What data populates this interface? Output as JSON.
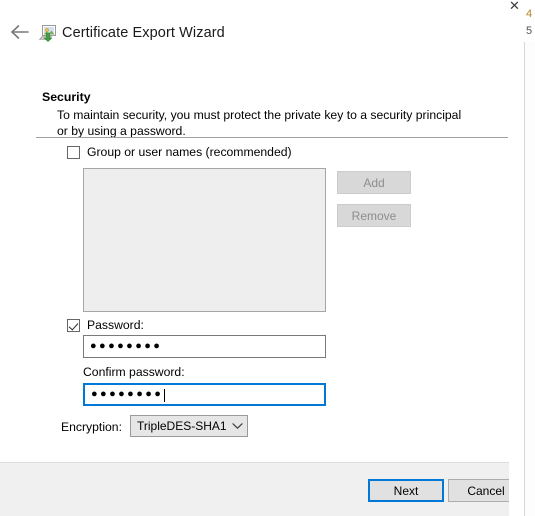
{
  "window": {
    "title": "Certificate Export Wizard",
    "back_icon": "back-arrow-icon",
    "app_icon": "certificate-export-icon"
  },
  "background_window": {
    "close_label": "✕",
    "fragment_top": "4",
    "fragment_second": "5"
  },
  "page": {
    "heading": "Security",
    "description": "To maintain security, you must protect the private key to a security principal or by using a password."
  },
  "group_names": {
    "checkbox_label": "Group or user names (recommended)",
    "checked": false,
    "list_items": [],
    "add_label": "Add",
    "remove_label": "Remove",
    "add_enabled": false,
    "remove_enabled": false
  },
  "password": {
    "checkbox_label": "Password:",
    "checked": true,
    "value": "●●●●●●●●",
    "confirm_label": "Confirm password:",
    "confirm_value": "●●●●●●●●",
    "confirm_focused": true
  },
  "encryption": {
    "label": "Encryption:",
    "selected": "TripleDES-SHA1",
    "chevron_icon": "chevron-down-icon"
  },
  "footer": {
    "next_label": "Next",
    "cancel_label": "Cancel"
  },
  "colors": {
    "accent": "#0078d7",
    "dialog_bg": "#f0f0f0",
    "content_bg": "#ffffff",
    "disabled_text": "#8d8d8d"
  }
}
